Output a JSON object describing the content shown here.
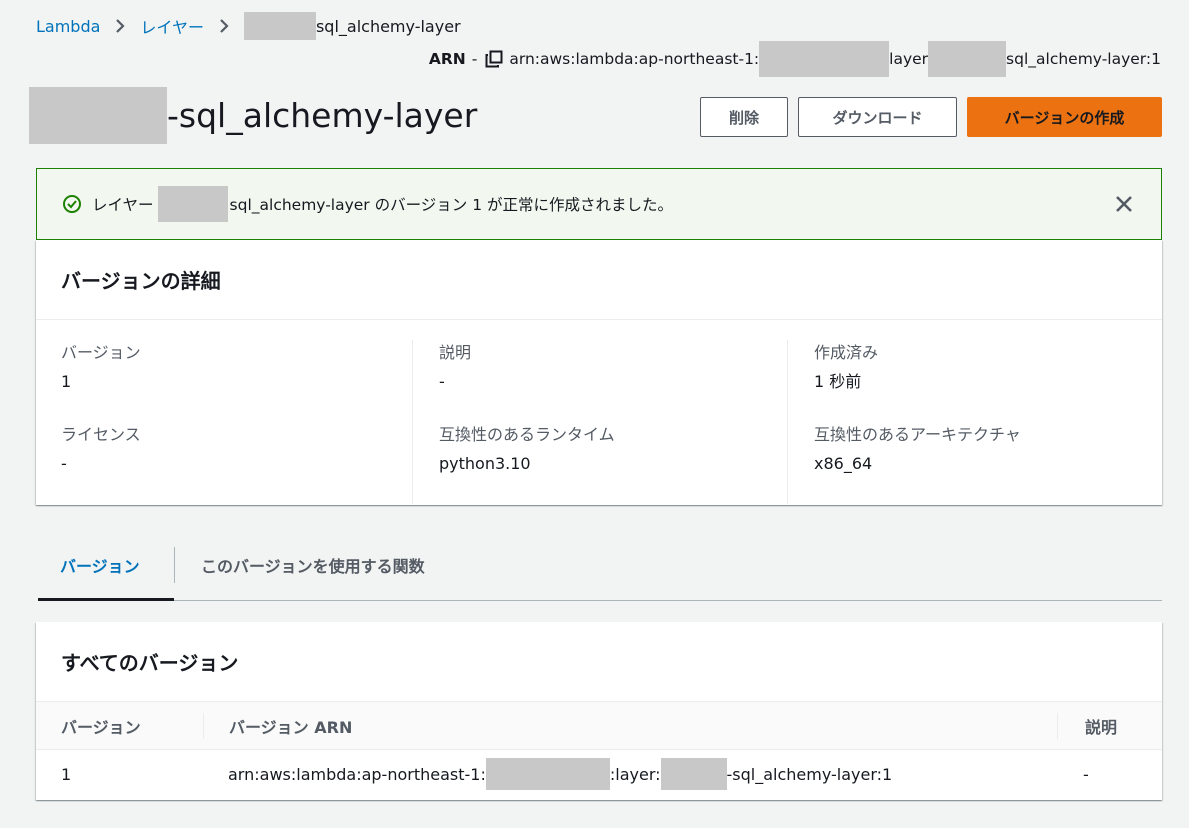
{
  "breadcrumb": {
    "root": "Lambda",
    "layers": "レイヤー",
    "current_suffix": "sql_alchemy-layer"
  },
  "arn": {
    "label": "ARN",
    "dash": "-",
    "part1": "arn:aws:lambda:ap-northeast-1:",
    "part2": "layer",
    "part3": "sql_alchemy-layer:1"
  },
  "title": {
    "suffix": "-sql_alchemy-layer"
  },
  "buttons": {
    "delete": "削除",
    "download": "ダウンロード",
    "create_version": "バージョンの作成"
  },
  "flash": {
    "prefix": "レイヤー",
    "suffix": "sql_alchemy-layer のバージョン 1 が正常に作成されました。"
  },
  "details": {
    "header": "バージョンの詳細",
    "version_label": "バージョン",
    "version_value": "1",
    "description_label": "説明",
    "description_value": "-",
    "created_label": "作成済み",
    "created_value": "1 秒前",
    "license_label": "ライセンス",
    "license_value": "-",
    "runtimes_label": "互換性のあるランタイム",
    "runtimes_value": "python3.10",
    "arch_label": "互換性のあるアーキテクチャ",
    "arch_value": "x86_64"
  },
  "tabs": {
    "versions": "バージョン",
    "functions": "このバージョンを使用する関数"
  },
  "versions_table": {
    "header": "すべてのバージョン",
    "columns": [
      "バージョン",
      "バージョン ARN",
      "説明"
    ],
    "row": {
      "version": "1",
      "arn_part1": "arn:aws:lambda:ap-northeast-1:",
      "arn_part2": ":layer:",
      "arn_part3": "-sql_alchemy-layer:1",
      "description": "-"
    }
  },
  "colors": {
    "link": "#0073bb",
    "primary": "#ec7211",
    "success": "#1d8102"
  }
}
